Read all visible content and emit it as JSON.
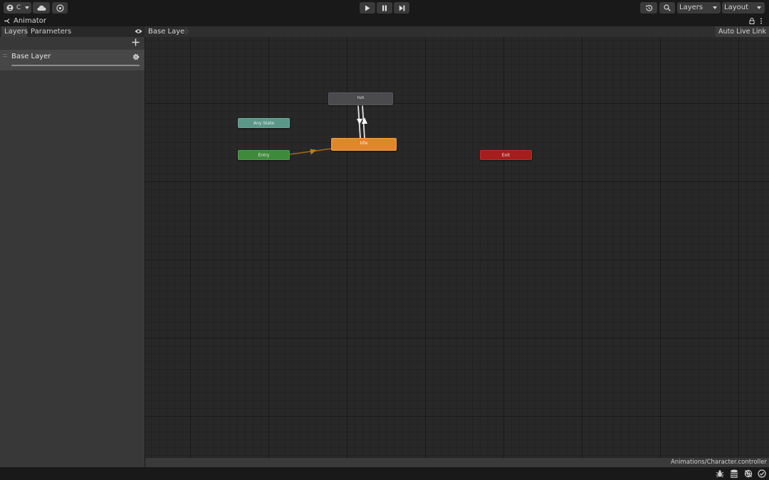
{
  "toolbar": {
    "account_label": "C",
    "layers_dropdown": "Layers",
    "layout_dropdown": "Layout"
  },
  "window": {
    "title": "Animator"
  },
  "left_panel": {
    "tabs": [
      "Layers",
      "Parameters"
    ],
    "layers": [
      {
        "name": "Base Layer"
      }
    ]
  },
  "graph": {
    "breadcrumb": "Base Layer",
    "auto_live_link": "Auto Live Link",
    "states": {
      "run": "run",
      "any_state": "Any State",
      "idle": "Idle",
      "entry": "Entry",
      "exit": "Exit"
    },
    "colors": {
      "default_state": "#e0872d",
      "normal_state": "#4b4b4e",
      "any_state": "#5a9788",
      "entry": "#3e8a3b",
      "exit": "#a51d1d",
      "entry_transition": "#9c6c22"
    }
  },
  "status": {
    "asset_path": "Animations/Character.controller"
  }
}
